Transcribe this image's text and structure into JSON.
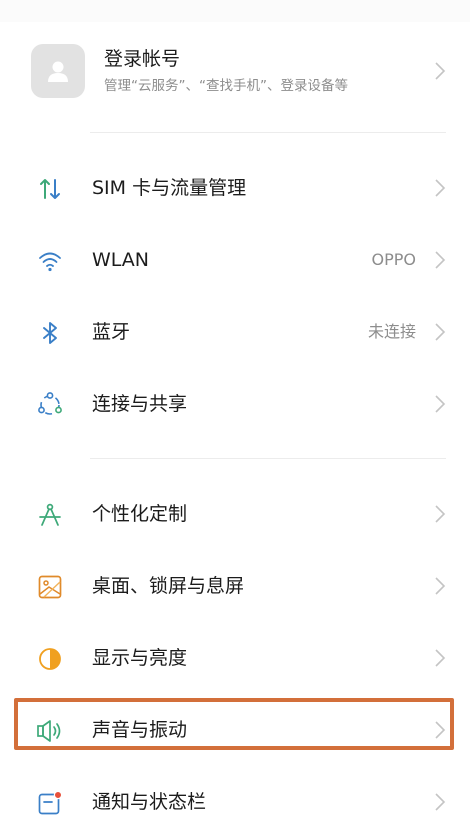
{
  "account": {
    "title": "登录帐号",
    "subtitle": "管理“云服务”、“查找手机”、登录设备等"
  },
  "groups": [
    {
      "items": [
        {
          "label": "SIM 卡与流量管理",
          "value": "",
          "icon": "sim-data-arrows-icon"
        },
        {
          "label": "WLAN",
          "value": "OPPO",
          "icon": "wifi-icon"
        },
        {
          "label": "蓝牙",
          "value": "未连接",
          "icon": "bluetooth-icon"
        },
        {
          "label": "连接与共享",
          "value": "",
          "icon": "connection-sharing-icon"
        }
      ]
    },
    {
      "items": [
        {
          "label": "个性化定制",
          "value": "",
          "icon": "compass-icon"
        },
        {
          "label": "桌面、锁屏与息屏",
          "value": "",
          "icon": "wallpaper-icon"
        },
        {
          "label": "显示与亮度",
          "value": "",
          "icon": "brightness-icon"
        },
        {
          "label": "声音与振动",
          "value": "",
          "icon": "speaker-icon"
        },
        {
          "label": "通知与状态栏",
          "value": "",
          "icon": "notification-icon"
        }
      ]
    }
  ],
  "colors": {
    "accent_green": "#3ea979",
    "accent_blue": "#3a7fc7",
    "accent_orange": "#f0a020",
    "highlight_border": "#d36f3a"
  }
}
